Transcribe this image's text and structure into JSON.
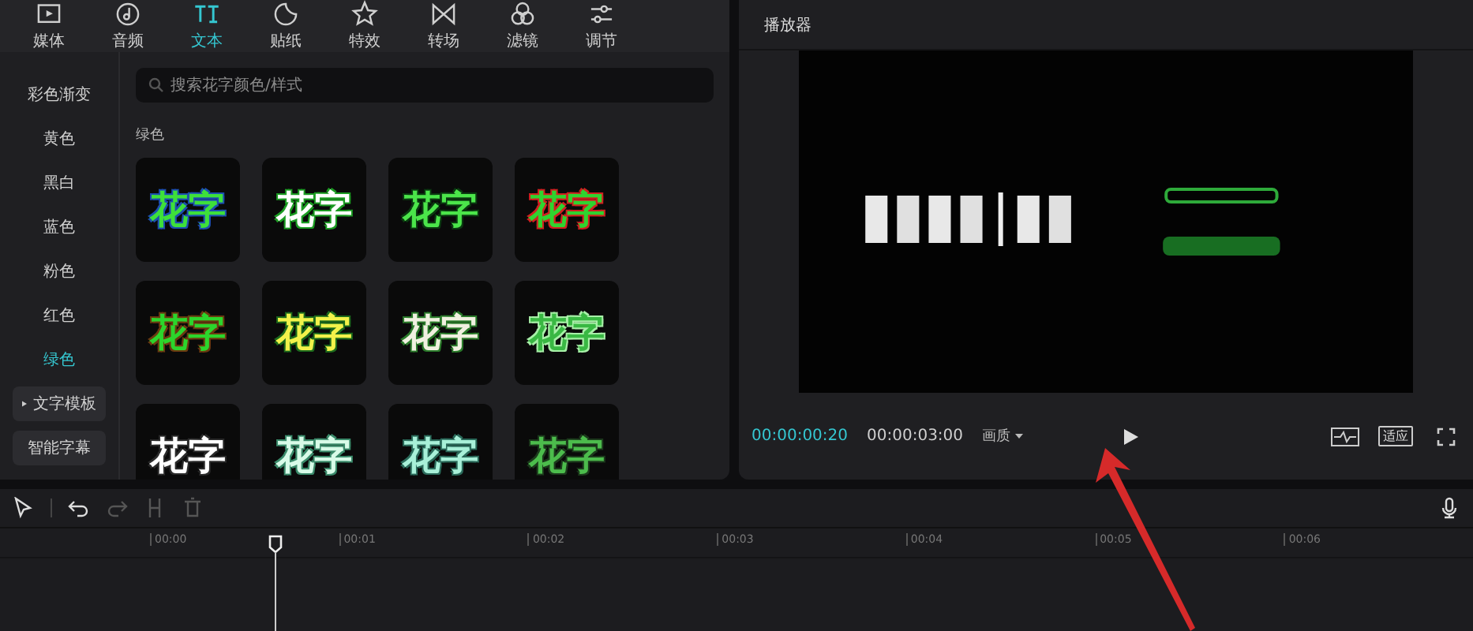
{
  "toolbar": {
    "tabs": [
      {
        "label": "媒体",
        "selected": false
      },
      {
        "label": "音频",
        "selected": false
      },
      {
        "label": "文本",
        "selected": true
      },
      {
        "label": "贴纸",
        "selected": false
      },
      {
        "label": "特效",
        "selected": false
      },
      {
        "label": "转场",
        "selected": false
      },
      {
        "label": "滤镜",
        "selected": false
      },
      {
        "label": "调节",
        "selected": false
      }
    ]
  },
  "sidebar": {
    "items": [
      {
        "label": "彩色渐变",
        "selected": false,
        "kind": "item"
      },
      {
        "label": "黄色",
        "selected": false,
        "kind": "item"
      },
      {
        "label": "黑白",
        "selected": false,
        "kind": "item"
      },
      {
        "label": "蓝色",
        "selected": false,
        "kind": "item"
      },
      {
        "label": "粉色",
        "selected": false,
        "kind": "item"
      },
      {
        "label": "红色",
        "selected": false,
        "kind": "item"
      },
      {
        "label": "绿色",
        "selected": true,
        "kind": "item"
      },
      {
        "label": "文字模板",
        "selected": false,
        "kind": "group"
      },
      {
        "label": "智能字幕",
        "selected": false,
        "kind": "button"
      }
    ]
  },
  "search": {
    "placeholder": "搜索花字颜色/样式"
  },
  "section_title": "绿色",
  "styles": [
    {
      "text": "花字",
      "color": "#3ee03a"
    },
    {
      "text": "花字",
      "color": "#ffffff"
    },
    {
      "text": "花字",
      "color": "#4be54a"
    },
    {
      "text": "花字",
      "color": "#2fd42f"
    },
    {
      "text": "花字",
      "color": "#2cd52c"
    },
    {
      "text": "花字",
      "color": "#f2f24a"
    },
    {
      "text": "花字",
      "color": "#f0f0e0"
    },
    {
      "text": "花字",
      "color": "#39b843"
    },
    {
      "text": "花字",
      "color": "#ffffff"
    },
    {
      "text": "花字",
      "color": "#d8fbe8"
    },
    {
      "text": "花字",
      "color": "#a8f0d8"
    },
    {
      "text": "花字",
      "color": "#4cbc4c"
    }
  ],
  "player": {
    "title": "播放器",
    "current_time": "00:00:00:20",
    "total_time": "00:00:03:00",
    "quality": "画质",
    "fit_button": "适应"
  },
  "timeline": {
    "ruler": [
      "00:00",
      "00:01",
      "00:02",
      "00:03",
      "00:04",
      "00:05",
      "00:06"
    ]
  }
}
